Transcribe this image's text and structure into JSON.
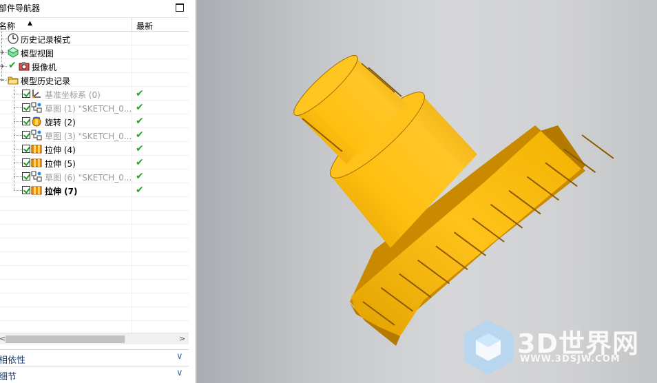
{
  "navigator": {
    "title": "部件导航器",
    "columns": {
      "name": "名称",
      "sort_glyph": "▲",
      "latest": "最新"
    },
    "rows": [
      {
        "label": "历史记录模式",
        "icon": "clock-icon",
        "style": "normal",
        "latest": ""
      },
      {
        "label": "模型视图",
        "icon": "model-views-icon",
        "style": "normal",
        "latest": ""
      },
      {
        "label": "摄像机",
        "icon": "camera-icon",
        "style": "normal",
        "latest": ""
      },
      {
        "label": "模型历史记录",
        "icon": "folder-icon",
        "style": "normal",
        "latest": ""
      },
      {
        "label": "基准坐标系 (0)",
        "icon": "datum-csys-icon",
        "style": "gray",
        "latest": "✔"
      },
      {
        "label": "草图 (1) \"SKETCH_0...",
        "icon": "sketch-icon",
        "style": "gray",
        "latest": "✔"
      },
      {
        "label": "旋转 (2)",
        "icon": "revolve-icon",
        "style": "normal",
        "latest": "✔"
      },
      {
        "label": "草图 (3) \"SKETCH_0...",
        "icon": "sketch-icon",
        "style": "gray",
        "latest": "✔"
      },
      {
        "label": "拉伸 (4)",
        "icon": "extrude-icon",
        "style": "normal",
        "latest": "✔"
      },
      {
        "label": "拉伸 (5)",
        "icon": "extrude-icon",
        "style": "normal",
        "latest": "✔"
      },
      {
        "label": "草图 (6) \"SKETCH_0...",
        "icon": "sketch-icon",
        "style": "gray",
        "latest": "✔"
      },
      {
        "label": "拉伸 (7)",
        "icon": "extrude-icon",
        "style": "bold",
        "latest": "✔"
      }
    ],
    "scroll_left": "<",
    "scroll_right": ">",
    "sections": [
      {
        "label": "相依性",
        "chevron": "∨"
      },
      {
        "label": "细节",
        "chevron": "∨"
      }
    ]
  },
  "watermark": {
    "title": "3D世界网",
    "url": "WWW.3DSJW.COM"
  },
  "colors": {
    "part_yellow": "#f5b800",
    "part_shadow": "#c98a00",
    "latest_check": "#27a32a",
    "section_text": "#1e3d6b"
  }
}
